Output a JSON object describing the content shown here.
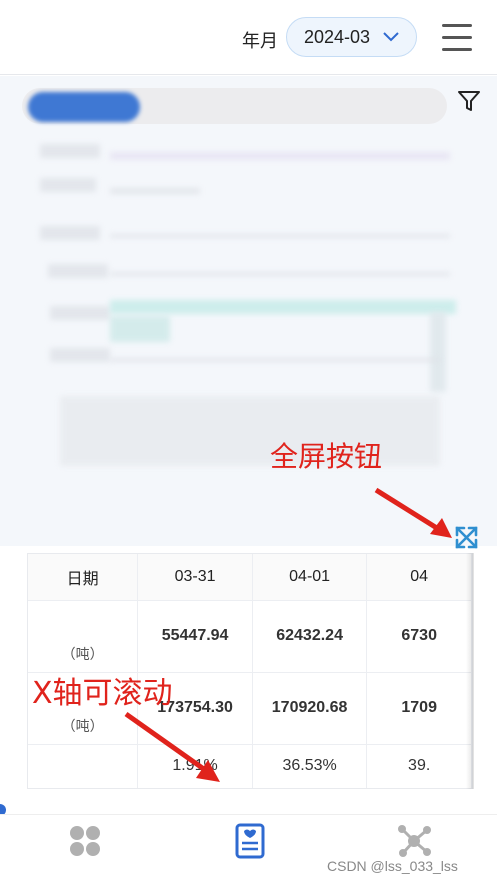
{
  "header": {
    "year_month_label": "年月",
    "selected_month": "2024-03"
  },
  "annotations": {
    "fullscreen_label": "全屏按钮",
    "x_scroll_label": "X轴可滚动"
  },
  "table": {
    "header": [
      "日期",
      "03-31",
      "04-01",
      "04"
    ],
    "rows": [
      {
        "label": "（吨）",
        "values": [
          "55447.94",
          "62432.24",
          "6730"
        ]
      },
      {
        "label": "（吨）",
        "values": [
          "173754.30",
          "170920.68",
          "1709"
        ]
      },
      {
        "label": "",
        "values": [
          "1.91%",
          "36.53%",
          "39."
        ]
      }
    ]
  },
  "watermark": "CSDN @lss_033_lss",
  "colors": {
    "accent": "#2f8fd0",
    "annotation": "#e0231c",
    "nav_active": "#2f6ad0"
  }
}
